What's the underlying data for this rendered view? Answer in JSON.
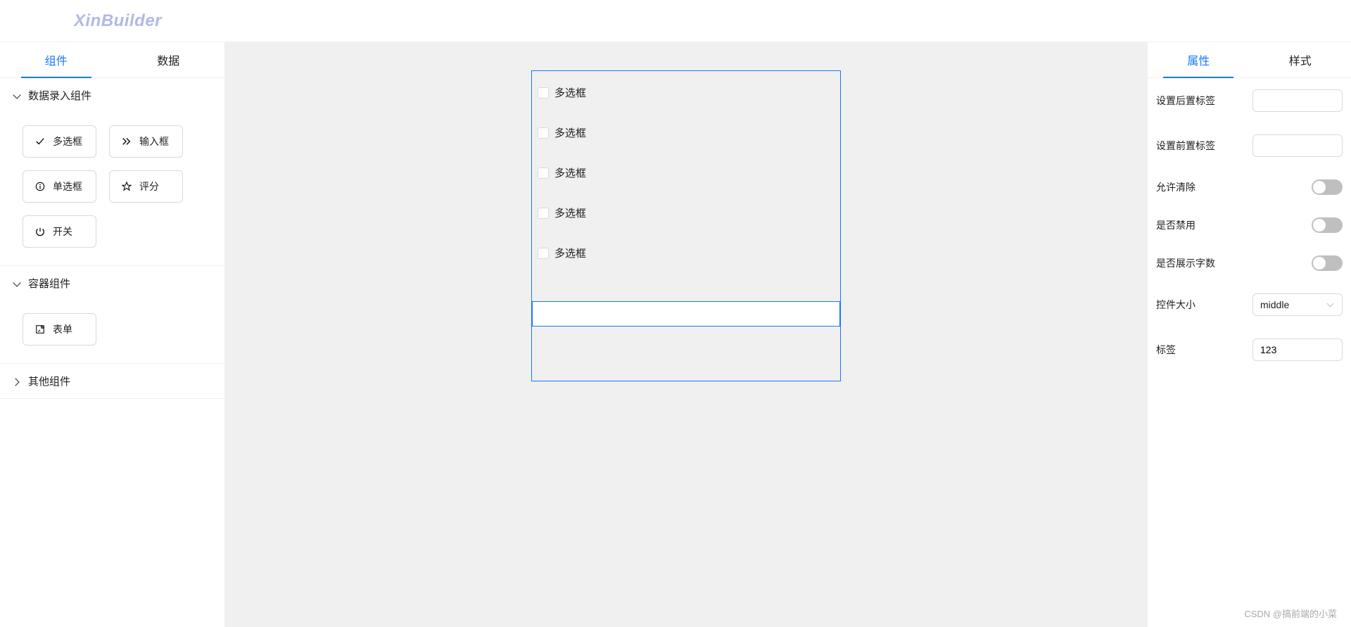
{
  "header": {
    "logo": "XinBuilder"
  },
  "leftPanel": {
    "tabs": {
      "component": "组件",
      "data": "数据"
    },
    "sections": {
      "dataEntry": {
        "title": "数据录入组件",
        "items": {
          "checkbox": "多选框",
          "input": "输入框",
          "radio": "单选框",
          "rate": "评分",
          "switch": "开关"
        }
      },
      "container": {
        "title": "容器组件",
        "items": {
          "form": "表单"
        }
      },
      "other": {
        "title": "其他组件"
      }
    }
  },
  "canvas": {
    "checkboxLabel": "多选框",
    "checkboxCount": 5
  },
  "rightPanel": {
    "tabs": {
      "attributes": "属性",
      "style": "样式"
    },
    "props": {
      "suffixLabel": {
        "label": "设置后置标签",
        "value": ""
      },
      "prefixLabel": {
        "label": "设置前置标签",
        "value": ""
      },
      "allowClear": {
        "label": "允许清除"
      },
      "disabled": {
        "label": "是否禁用"
      },
      "showCount": {
        "label": "是否展示字数"
      },
      "size": {
        "label": "控件大小",
        "value": "middle"
      },
      "tag": {
        "label": "标签",
        "value": "123"
      }
    }
  },
  "watermark": "CSDN @搞前端的小菜"
}
